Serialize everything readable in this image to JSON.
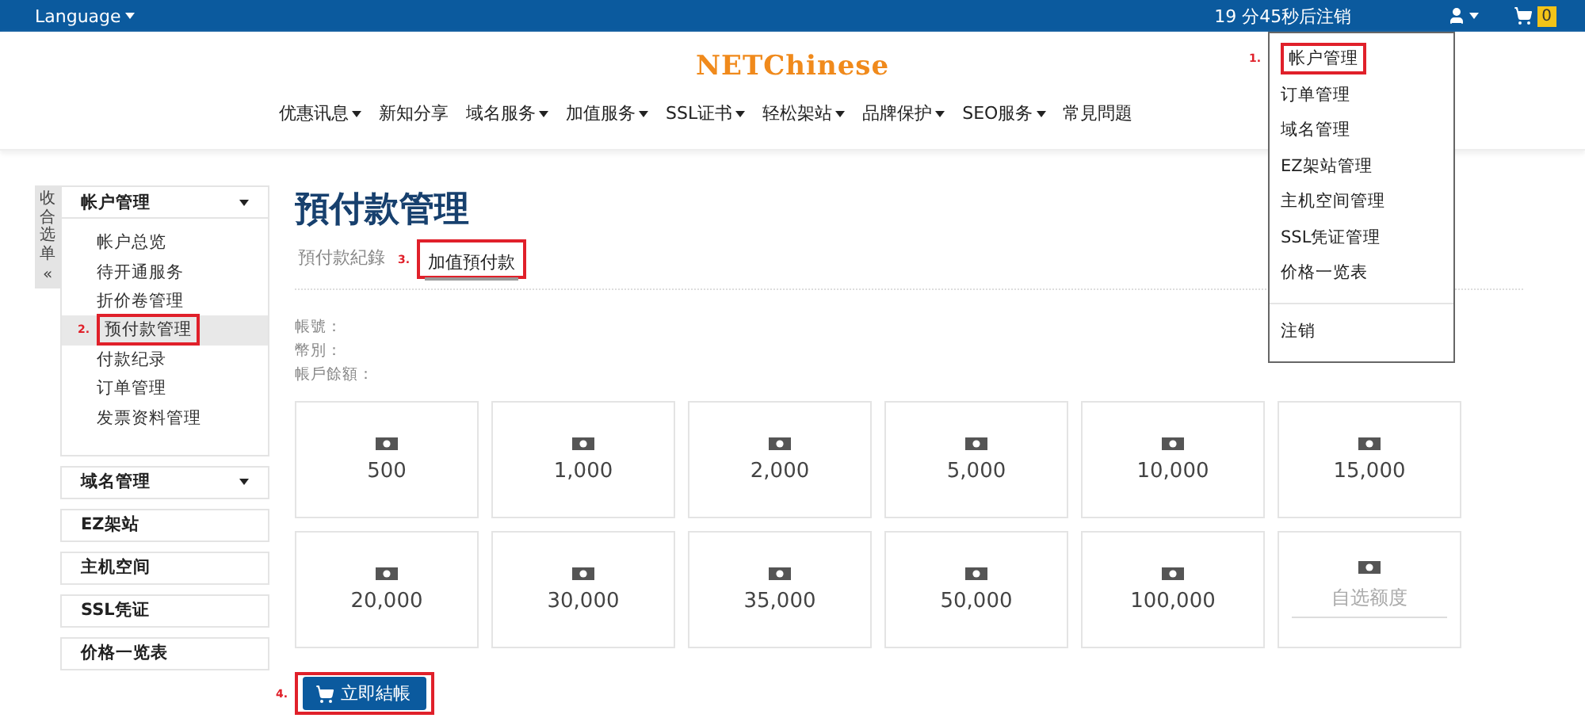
{
  "top_bar": {
    "language": "Language",
    "countdown": "19 分45秒后注销",
    "cart_count": "0"
  },
  "account_menu": {
    "items": [
      {
        "label": "帐户管理",
        "annotation": "1."
      },
      {
        "label": "订单管理"
      },
      {
        "label": "域名管理"
      },
      {
        "label": "EZ架站管理"
      },
      {
        "label": "主机空间管理"
      },
      {
        "label": "SSL凭证管理"
      },
      {
        "label": "价格一览表"
      }
    ],
    "logout": "注销"
  },
  "logo": {
    "text": "NETChinese"
  },
  "nav": {
    "items": [
      {
        "label": "优惠讯息",
        "has_menu": true
      },
      {
        "label": "新知分享",
        "has_menu": false
      },
      {
        "label": "域名服务",
        "has_menu": true
      },
      {
        "label": "加值服务",
        "has_menu": true
      },
      {
        "label": "SSL证书",
        "has_menu": true
      },
      {
        "label": "轻松架站",
        "has_menu": true
      },
      {
        "label": "品牌保护",
        "has_menu": true
      },
      {
        "label": "SEO服务",
        "has_menu": true
      },
      {
        "label": "常見問題",
        "has_menu": false
      }
    ]
  },
  "sidebar": {
    "collapse_label": "收合选单",
    "collapse_icon": "«",
    "sections": [
      {
        "title": "帐户管理",
        "expandable": true,
        "items": [
          {
            "label": "帐户总览",
            "selected": false
          },
          {
            "label": "待开通服务",
            "selected": false
          },
          {
            "label": "折价卷管理",
            "selected": false
          },
          {
            "label": "预付款管理",
            "selected": true,
            "annotation": "2."
          },
          {
            "label": "付款纪录",
            "selected": false
          },
          {
            "label": "订单管理",
            "selected": false
          },
          {
            "label": "发票资料管理",
            "selected": false
          }
        ]
      },
      {
        "title": "域名管理",
        "expandable": true
      },
      {
        "title": "EZ架站",
        "expandable": false
      },
      {
        "title": "主机空间",
        "expandable": false
      },
      {
        "title": "SSL凭证",
        "expandable": false
      },
      {
        "title": "价格一览表",
        "expandable": false
      }
    ]
  },
  "page": {
    "title": "預付款管理",
    "tabs": [
      {
        "label": "預付款紀錄",
        "selected": false
      },
      {
        "label": "加值預付款",
        "selected": true,
        "annotation": "3."
      }
    ],
    "account_fields": [
      "帳號：",
      "幣別：",
      "帳戶餘額："
    ],
    "amounts": [
      {
        "kind": "preset",
        "value": "500"
      },
      {
        "kind": "preset",
        "value": "1,000"
      },
      {
        "kind": "preset",
        "value": "2,000"
      },
      {
        "kind": "preset",
        "value": "5,000"
      },
      {
        "kind": "preset",
        "value": "10,000"
      },
      {
        "kind": "preset",
        "value": "15,000"
      },
      {
        "kind": "preset",
        "value": "20,000"
      },
      {
        "kind": "preset",
        "value": "30,000"
      },
      {
        "kind": "preset",
        "value": "35,000"
      },
      {
        "kind": "preset",
        "value": "50,000"
      },
      {
        "kind": "preset",
        "value": "100,000"
      },
      {
        "kind": "custom",
        "placeholder": "自选额度"
      }
    ],
    "checkout": {
      "label": "立即結帳",
      "annotation": "4."
    }
  }
}
